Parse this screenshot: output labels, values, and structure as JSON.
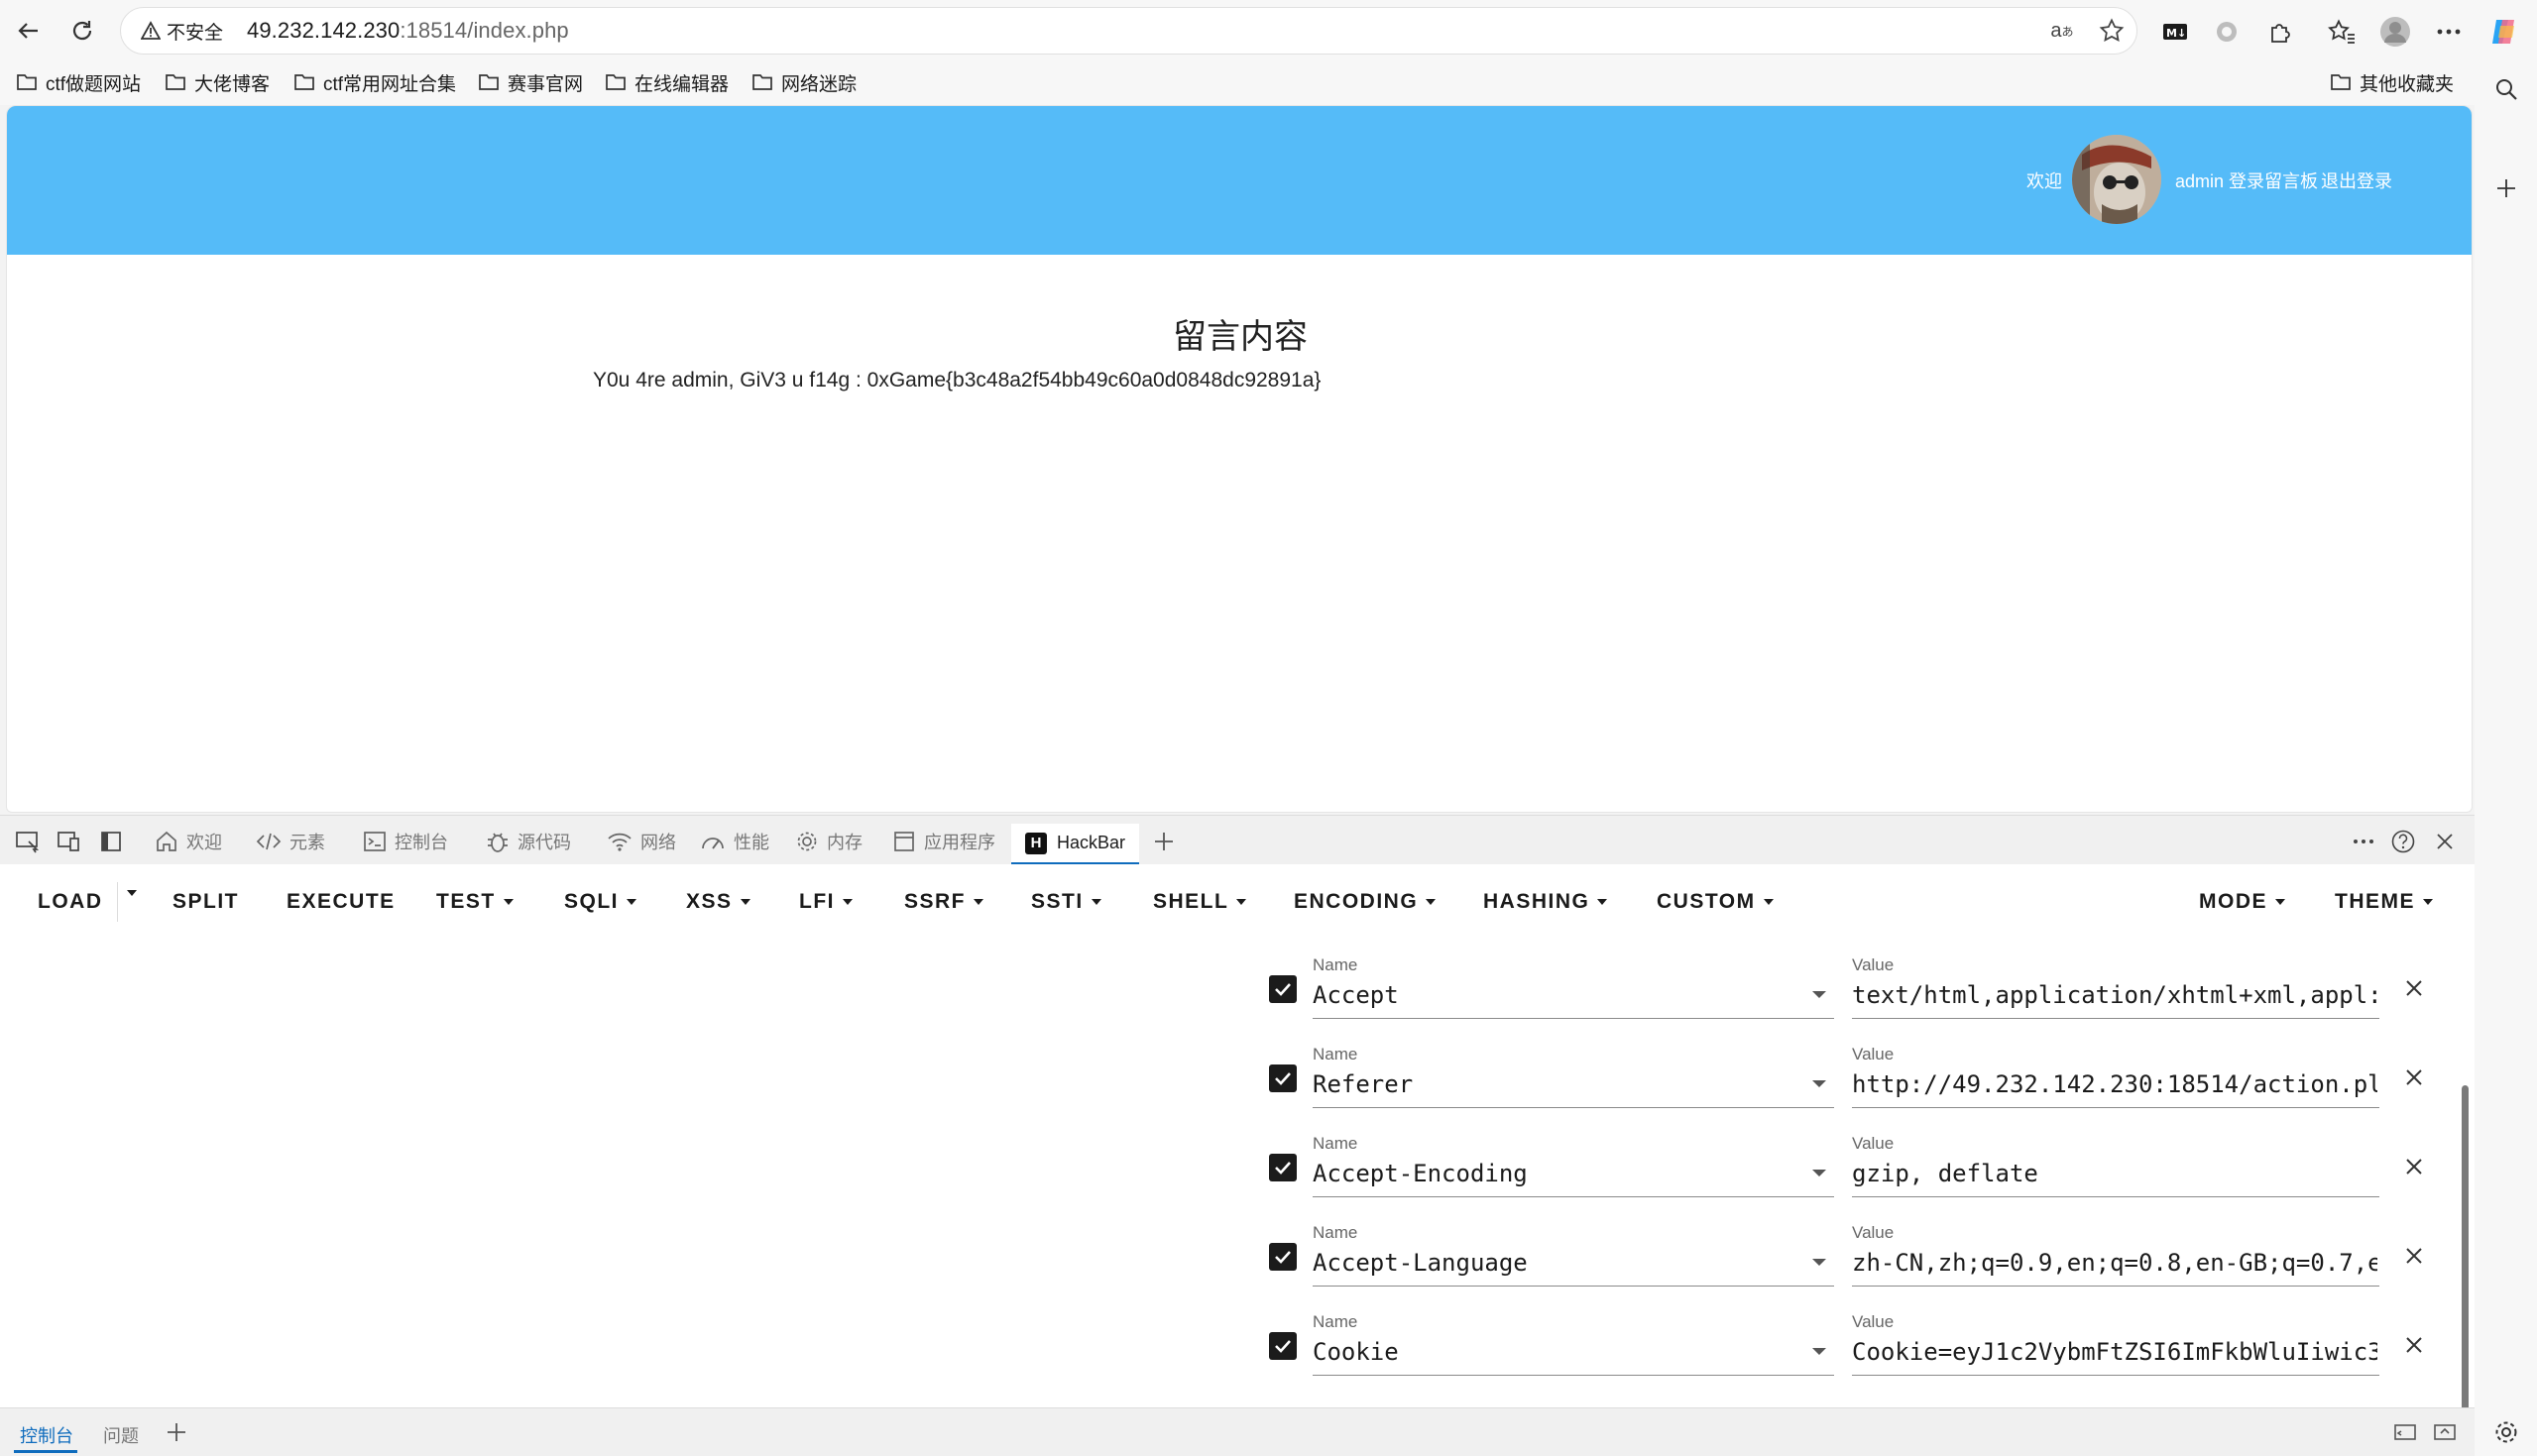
{
  "browser": {
    "security_label": "不安全",
    "url_host": "49.232.142.230",
    "url_rest": ":18514/index.php",
    "bookmarks": [
      "ctf做题网站",
      "大佬博客",
      "ctf常用网址合集",
      "赛事官网",
      "在线编辑器",
      "网络迷踪"
    ],
    "other_bookmarks": "其他收藏夹"
  },
  "site": {
    "welcome": "欢迎",
    "user_link": "admin 登录留言板",
    "logout": "退出登录",
    "title": "留言内容",
    "message": "Y0u 4re admin, GiV3 u f14g : 0xGame{b3c48a2f54bb49c60a0d0848dc92891a}",
    "header_color": "#55bbf8"
  },
  "devtools": {
    "tabs": [
      "欢迎",
      "元素",
      "控制台",
      "源代码",
      "网络",
      "性能",
      "内存",
      "应用程序"
    ],
    "active_tab": "HackBar",
    "drawer_tabs": [
      "控制台",
      "问题"
    ]
  },
  "hackbar": {
    "menu": {
      "load": "LOAD",
      "split": "SPLIT",
      "execute": "EXECUTE",
      "test": "TEST",
      "sqli": "SQLI",
      "xss": "XSS",
      "lfi": "LFI",
      "ssrf": "SSRF",
      "ssti": "SSTI",
      "shell": "SHELL",
      "encoding": "ENCODING",
      "hashing": "HASHING",
      "custom": "CUSTOM",
      "mode": "MODE",
      "theme": "THEME"
    },
    "name_label": "Name",
    "value_label": "Value",
    "headers": [
      {
        "name": "Accept",
        "value": "text/html,application/xhtml+xml,appl:",
        "checked": true
      },
      {
        "name": "Referer",
        "value": "http://49.232.142.230:18514/action.pl",
        "checked": true
      },
      {
        "name": "Accept-Encoding",
        "value": "gzip, deflate",
        "checked": true
      },
      {
        "name": "Accept-Language",
        "value": "zh-CN,zh;q=0.9,en;q=0.8,en-GB;q=0.7,e",
        "checked": true
      },
      {
        "name": "Cookie",
        "value": "Cookie=eyJ1c2VybmFtZSI6ImFkbWluIiwic3",
        "checked": true
      }
    ]
  }
}
